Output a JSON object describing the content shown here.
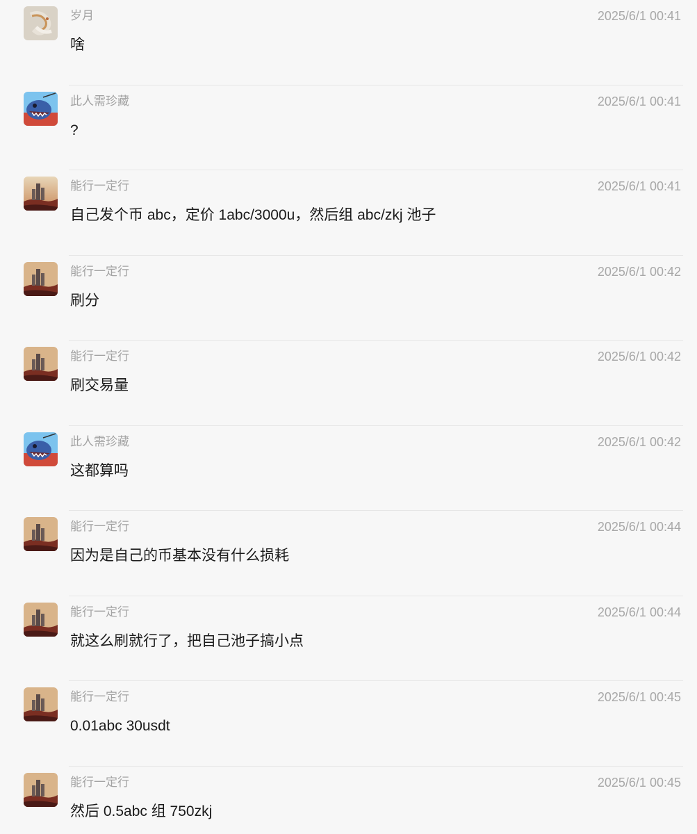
{
  "messages": [
    {
      "sender": "岁月",
      "time": "2025/6/1 00:41",
      "text": "啥",
      "avatar": "koi-fish-avatar"
    },
    {
      "sender": "此人需珍藏",
      "time": "2025/6/1 00:41",
      "text": "?",
      "avatar": "blue-creature-avatar"
    },
    {
      "sender": "能行一定行",
      "time": "2025/6/1 00:41",
      "text": "自己发个币 abc，定价 1abc/3000u，然后组 abc/zkj 池子",
      "avatar": "desert-castle-avatar"
    },
    {
      "sender": "能行一定行",
      "time": "2025/6/1 00:42",
      "text": "刷分",
      "avatar": "desert-castle-avatar"
    },
    {
      "sender": "能行一定行",
      "time": "2025/6/1 00:42",
      "text": "刷交易量",
      "avatar": "desert-castle-avatar"
    },
    {
      "sender": "此人需珍藏",
      "time": "2025/6/1 00:42",
      "text": "这都算吗",
      "avatar": "blue-creature-avatar"
    },
    {
      "sender": "能行一定行",
      "time": "2025/6/1 00:44",
      "text": "因为是自己的币基本没有什么损耗",
      "avatar": "desert-castle-avatar"
    },
    {
      "sender": "能行一定行",
      "time": "2025/6/1 00:44",
      "text": "就这么刷就行了，把自己池子搞小点",
      "avatar": "desert-castle-avatar"
    },
    {
      "sender": "能行一定行",
      "time": "2025/6/1 00:45",
      "text": "0.01abc 30usdt",
      "avatar": "desert-castle-avatar"
    },
    {
      "sender": "能行一定行",
      "time": "2025/6/1 00:45",
      "text": "然后 0.5abc 组 750zkj",
      "avatar": "desert-castle-avatar"
    }
  ]
}
